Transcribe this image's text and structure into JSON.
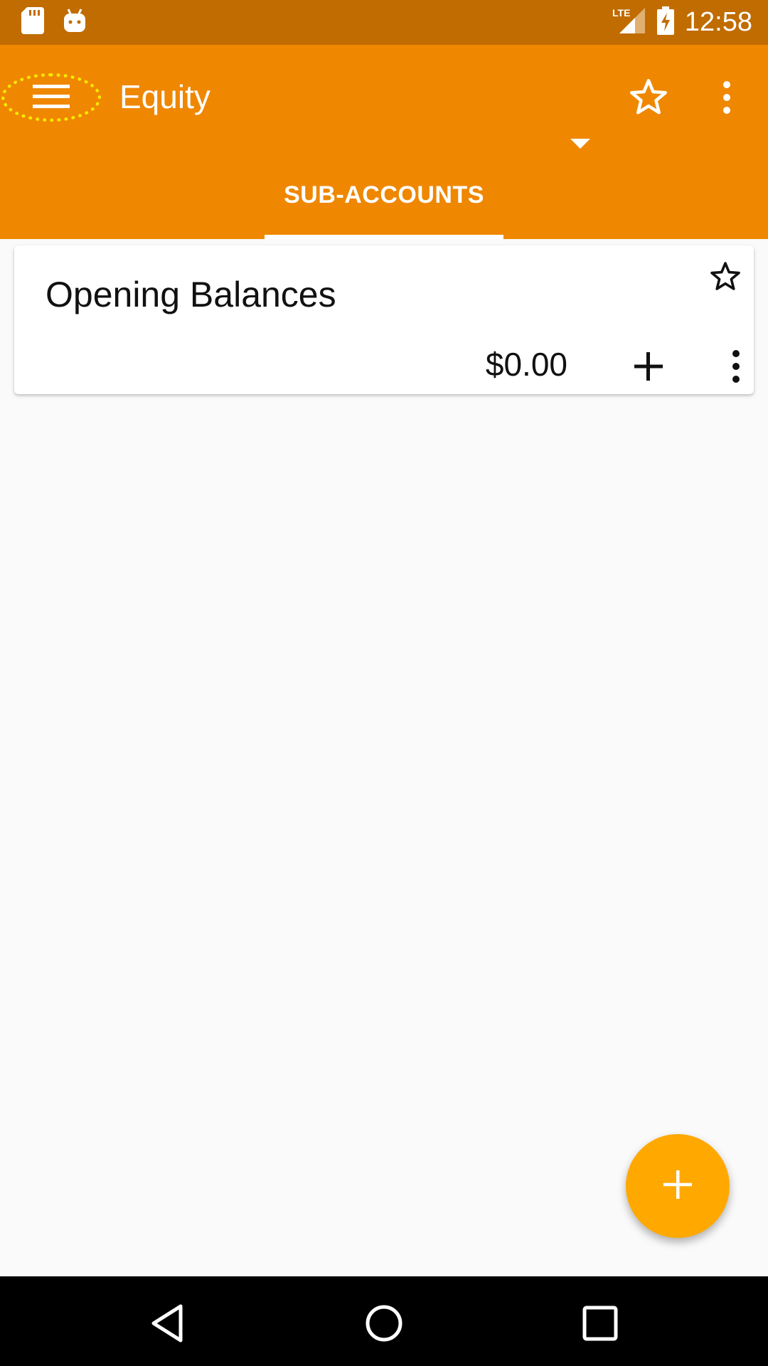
{
  "status_bar": {
    "time": "12:58",
    "network_label": "LTE",
    "icons": [
      "sd-card-icon",
      "android-icon",
      "lte-signal-icon",
      "battery-charging-icon"
    ]
  },
  "app_bar": {
    "title": "Equity",
    "icons": [
      "menu-icon",
      "dropdown-icon",
      "star-outline-icon",
      "more-vert-icon"
    ],
    "accent_color": "#ef8700",
    "status_bar_color": "#c06c00"
  },
  "tabs": [
    {
      "label": "SUB-ACCOUNTS",
      "selected": true
    }
  ],
  "accounts": [
    {
      "name": "Opening Balances",
      "balance": "$0.00",
      "favorite": false
    }
  ],
  "fab": {
    "icon": "add-icon",
    "color": "#ffa900"
  },
  "nav_bar": {
    "icons": [
      "back-icon",
      "home-icon",
      "recents-icon"
    ]
  }
}
